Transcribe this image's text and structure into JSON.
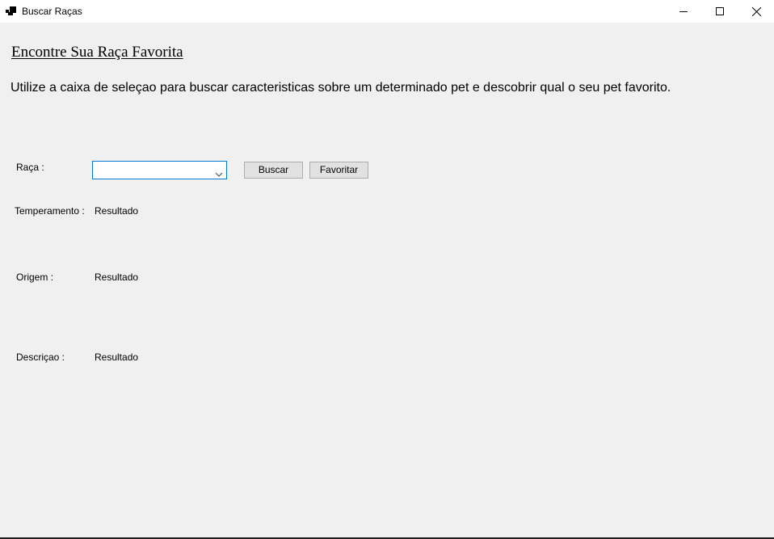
{
  "window": {
    "title": "Buscar Raças",
    "icons": {
      "app": "app-icon",
      "minimize": "minimize-icon",
      "maximize": "maximize-icon",
      "close": "close-icon"
    }
  },
  "header": {
    "title": "Encontre Sua Raça Favorita",
    "subtitle": "Utilize a caixa de seleçao para buscar caracteristicas sobre um determinado pet e descobrir qual o seu pet favorito."
  },
  "form": {
    "raca_label": "Raça :",
    "raca_selected": "",
    "buscar_label": "Buscar",
    "favoritar_label": "Favoritar"
  },
  "results": {
    "temperamento_label": "Temperamento :",
    "temperamento_value": "Resultado",
    "origem_label": "Origem :",
    "origem_value": "Resultado",
    "descricao_label": "Descriçao :",
    "descricao_value": "Resultado"
  },
  "colors": {
    "background": "#f0f0f0",
    "titlebar": "#ffffff",
    "combo_focus_border": "#0078d7",
    "button_face": "#e1e1e1",
    "button_border": "#adadad"
  }
}
